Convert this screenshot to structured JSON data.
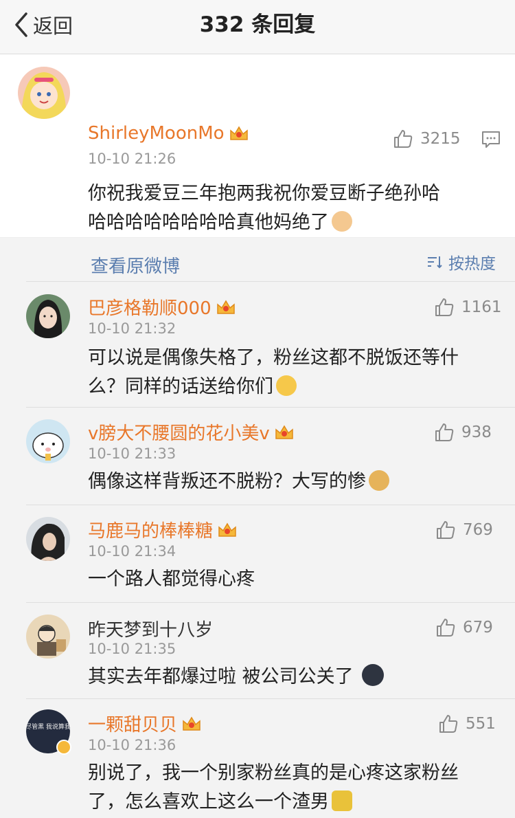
{
  "nav": {
    "back_label": "返回",
    "title": "332 条回复"
  },
  "main_comment": {
    "username": "ShirleyMoonMo",
    "time": "10-10 21:26",
    "likes": "3215",
    "text_line1": "你祝我爱豆三年抱两我祝你爱豆断子绝孙哈",
    "text_line2": "哈哈哈哈哈哈哈哈真他妈绝了",
    "view_original": "查看原微博"
  },
  "sort": {
    "label": "按热度"
  },
  "replies": [
    {
      "username": "巴彦格勒顺000",
      "time": "10-10 21:32",
      "likes": "1161",
      "line1": "可以说是偶像失格了，粉丝这都不脱饭还等什",
      "line2": "么？同样的话送给你们"
    },
    {
      "username": "v膀大不腰圆的花小美v",
      "time": "10-10 21:33",
      "likes": "938",
      "line1": "偶像这样背叛还不脱粉？大写的惨"
    },
    {
      "username": "马鹿马的棒棒糖",
      "time": "10-10 21:34",
      "likes": "769",
      "line1": "一个路人都觉得心疼"
    },
    {
      "username": "昨天梦到十八岁",
      "time": "10-10 21:35",
      "likes": "679",
      "line1": "其实去年都爆过啦 被公司公关了"
    },
    {
      "username": "一颗甜贝贝",
      "time": "10-10 21:36",
      "likes": "551",
      "line1": "别说了，我一个别家粉丝真的是心疼这家粉丝",
      "line2": "了，怎么喜欢上这么一个渣男"
    }
  ],
  "avatar5_text": "你尽管黑 我说算我的"
}
